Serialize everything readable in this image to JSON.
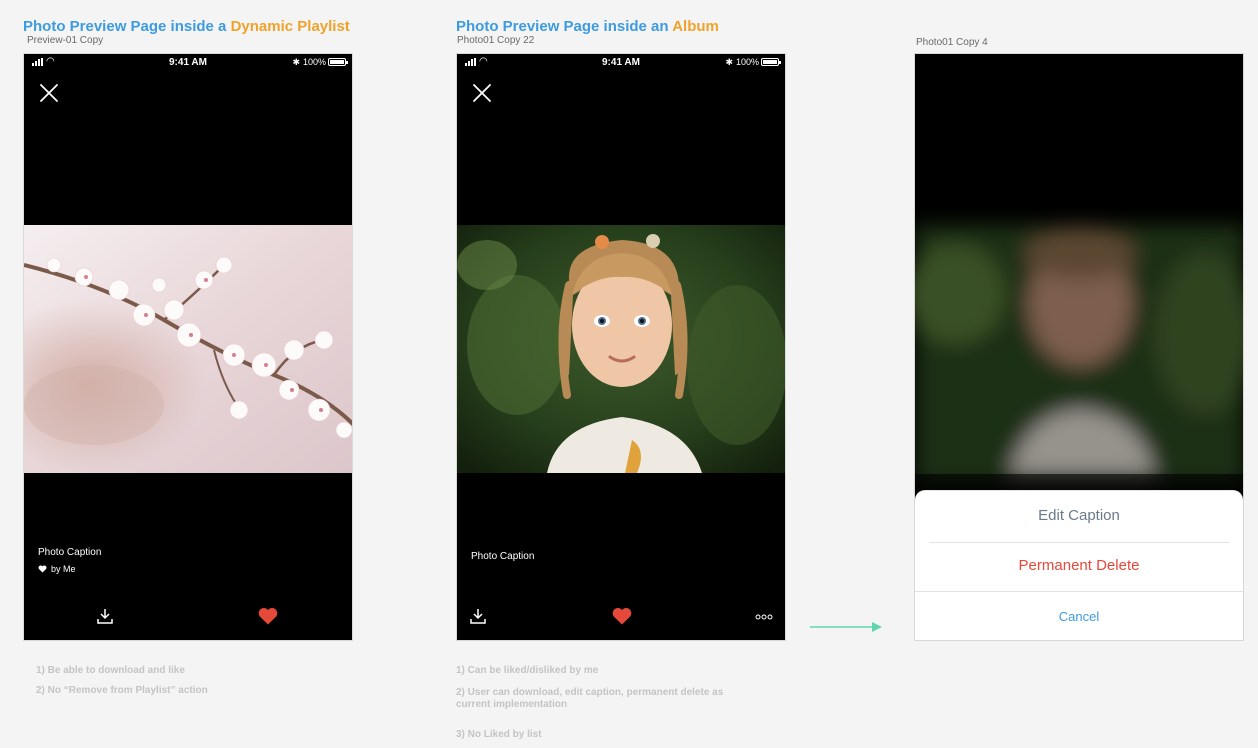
{
  "colors": {
    "title_blue": "#3d9be0",
    "title_orange": "#f0a32c",
    "heart_red": "#e5493a",
    "delete_red": "#e5493a",
    "cancel_blue": "#3d9be0",
    "edit_gray": "#6a7a8a",
    "arrow_teal": "#5fd6ad"
  },
  "sections": [
    {
      "title_prefix": "Photo Preview Page inside a ",
      "title_accent": "Dynamic Playlist",
      "artboard": "Preview-01 Copy",
      "status": {
        "time": "9:41 AM",
        "battery_pct": "100%"
      },
      "caption": "Photo Caption",
      "liked_by": "by Me",
      "notes": [
        "1) Be able to download and like",
        "2) No “Remove from Playlist” action"
      ]
    },
    {
      "title_prefix": "Photo Preview Page inside an ",
      "title_accent": "Album",
      "artboard": "Photo01 Copy 22",
      "status": {
        "time": "9:41 AM",
        "battery_pct": "100%"
      },
      "caption": "Photo Caption",
      "notes": [
        "1) Can be liked/disliked by me",
        "2) User can download, edit caption, permanent delete as current implementation",
        "3) No Liked by list"
      ]
    },
    {
      "artboard": "Photo01 Copy 4",
      "sheet": {
        "edit": "Edit Caption",
        "delete": "Permanent Delete",
        "cancel": "Cancel"
      }
    }
  ],
  "icons": [
    "close-icon",
    "download-icon",
    "heart-icon",
    "more-icon",
    "arrow-right-icon",
    "signal-icon",
    "wifi-icon",
    "bluetooth-icon",
    "battery-icon"
  ]
}
